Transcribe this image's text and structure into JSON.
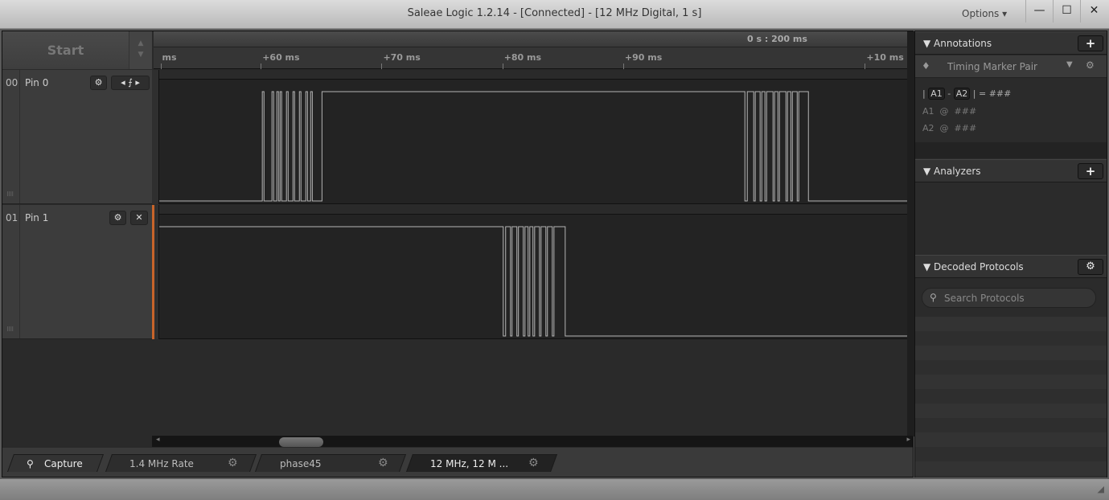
{
  "window": {
    "title": "Saleae Logic 1.2.14 - [Connected] - [12 MHz Digital, 1 s]",
    "options_label": "Options ▾",
    "minimize": "—",
    "maximize": "☐",
    "close": "✕"
  },
  "toolbar": {
    "start_label": "Start"
  },
  "ruler": {
    "marker_label": "0 s : 200 ms",
    "ticks": [
      {
        "label": "ms",
        "ms": 51.7
      },
      {
        "label": "+60 ms",
        "ms": 60
      },
      {
        "label": "+70 ms",
        "ms": 70
      },
      {
        "label": "+80 ms",
        "ms": 80
      },
      {
        "label": "+90 ms",
        "ms": 90
      },
      {
        "label": "+10 ms",
        "ms": 110
      }
    ],
    "view_ms": [
      51.6,
      113.5
    ]
  },
  "channels": [
    {
      "num": "00",
      "name": "Pin 0",
      "initial": 0,
      "edges_ms": [
        60.13,
        60.27,
        60.93,
        61.07,
        61.33,
        61.47,
        61.6,
        61.73,
        62.13,
        62.27,
        62.67,
        62.8,
        63.2,
        63.33,
        63.73,
        63.87,
        64.13,
        64.27,
        65.07,
        100.07,
        100.27,
        100.8,
        100.93,
        101.33,
        101.47,
        101.73,
        101.87,
        102.4,
        102.53,
        102.8,
        102.93,
        103.47,
        103.6,
        103.87,
        104.0,
        104.4,
        104.53,
        105.33
      ]
    },
    {
      "num": "01",
      "name": "Pin 1",
      "initial": 1,
      "edges_ms": [
        80.07,
        80.27,
        80.67,
        80.8,
        81.2,
        81.33,
        81.73,
        81.87,
        82.13,
        82.27,
        82.53,
        82.67,
        83.07,
        83.2,
        83.6,
        83.73,
        84.13,
        84.27,
        85.2
      ]
    }
  ],
  "tabs": [
    {
      "label": "Capture",
      "icon": "search-icon"
    },
    {
      "label": "1.4 MHz Rate"
    },
    {
      "label": "phase45"
    },
    {
      "label": "12 MHz, 12 M ..."
    }
  ],
  "annotations": {
    "title": "Annotations",
    "add": "+",
    "marker": "Timing Marker Pair",
    "formula": {
      "bar": "|",
      "a1": "A1",
      "dash": "-",
      "a2": "A2",
      "eq": "| =",
      "val": "###"
    },
    "rows": [
      {
        "name": "A1",
        "at": "@",
        "val": "###"
      },
      {
        "name": "A2",
        "at": "@",
        "val": "###"
      }
    ]
  },
  "analyzers": {
    "title": "Analyzers",
    "add": "+"
  },
  "decoded": {
    "title": "Decoded Protocols",
    "search_placeholder": "Search Protocols"
  },
  "colors": {
    "wave": "#b5b5b5",
    "accent": "#c8642a"
  }
}
